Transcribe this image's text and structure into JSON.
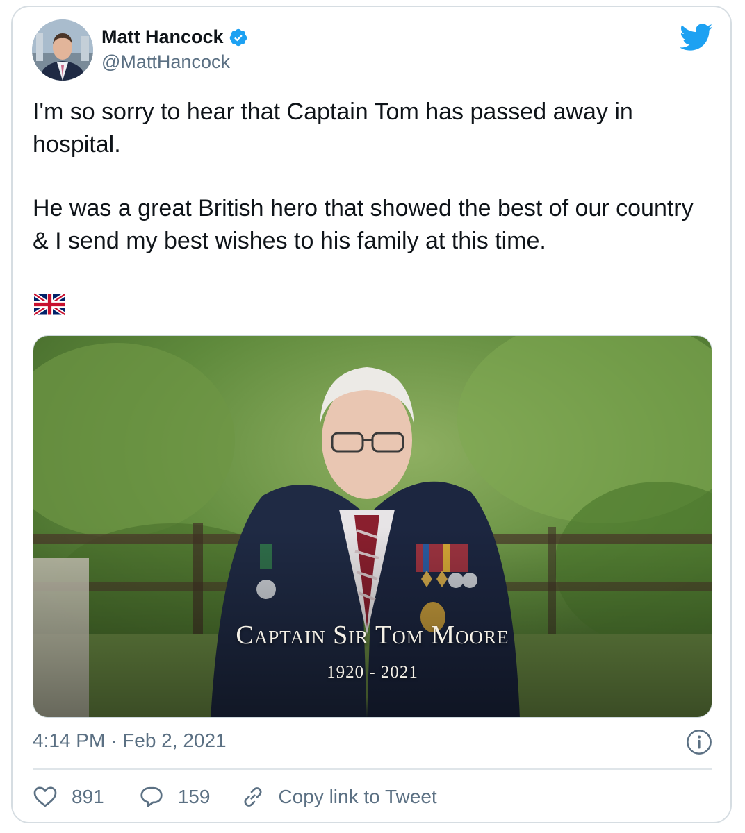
{
  "author": {
    "display_name": "Matt Hancock",
    "handle": "@MattHancock",
    "verified": true,
    "avatar_icon": "avatar-photo"
  },
  "tweet": {
    "paragraphs": [
      "I'm so sorry to hear that Captain Tom has passed away in hospital.",
      "He was a great British hero that showed the best of our country & I send my best wishes to his family at this time."
    ],
    "emoji": "union-jack-flag-icon"
  },
  "media": {
    "caption_name": "Captain Sir Tom Moore",
    "caption_years": "1920 - 2021"
  },
  "meta": {
    "timestamp": "4:14 PM · Feb 2, 2021"
  },
  "actions": {
    "likes": "891",
    "replies": "159",
    "copy_link": "Copy link to Tweet"
  },
  "colors": {
    "twitter_blue": "#1da1f2",
    "text_primary": "#0f1419",
    "text_secondary": "#5b7083",
    "border": "#d6dde2"
  }
}
